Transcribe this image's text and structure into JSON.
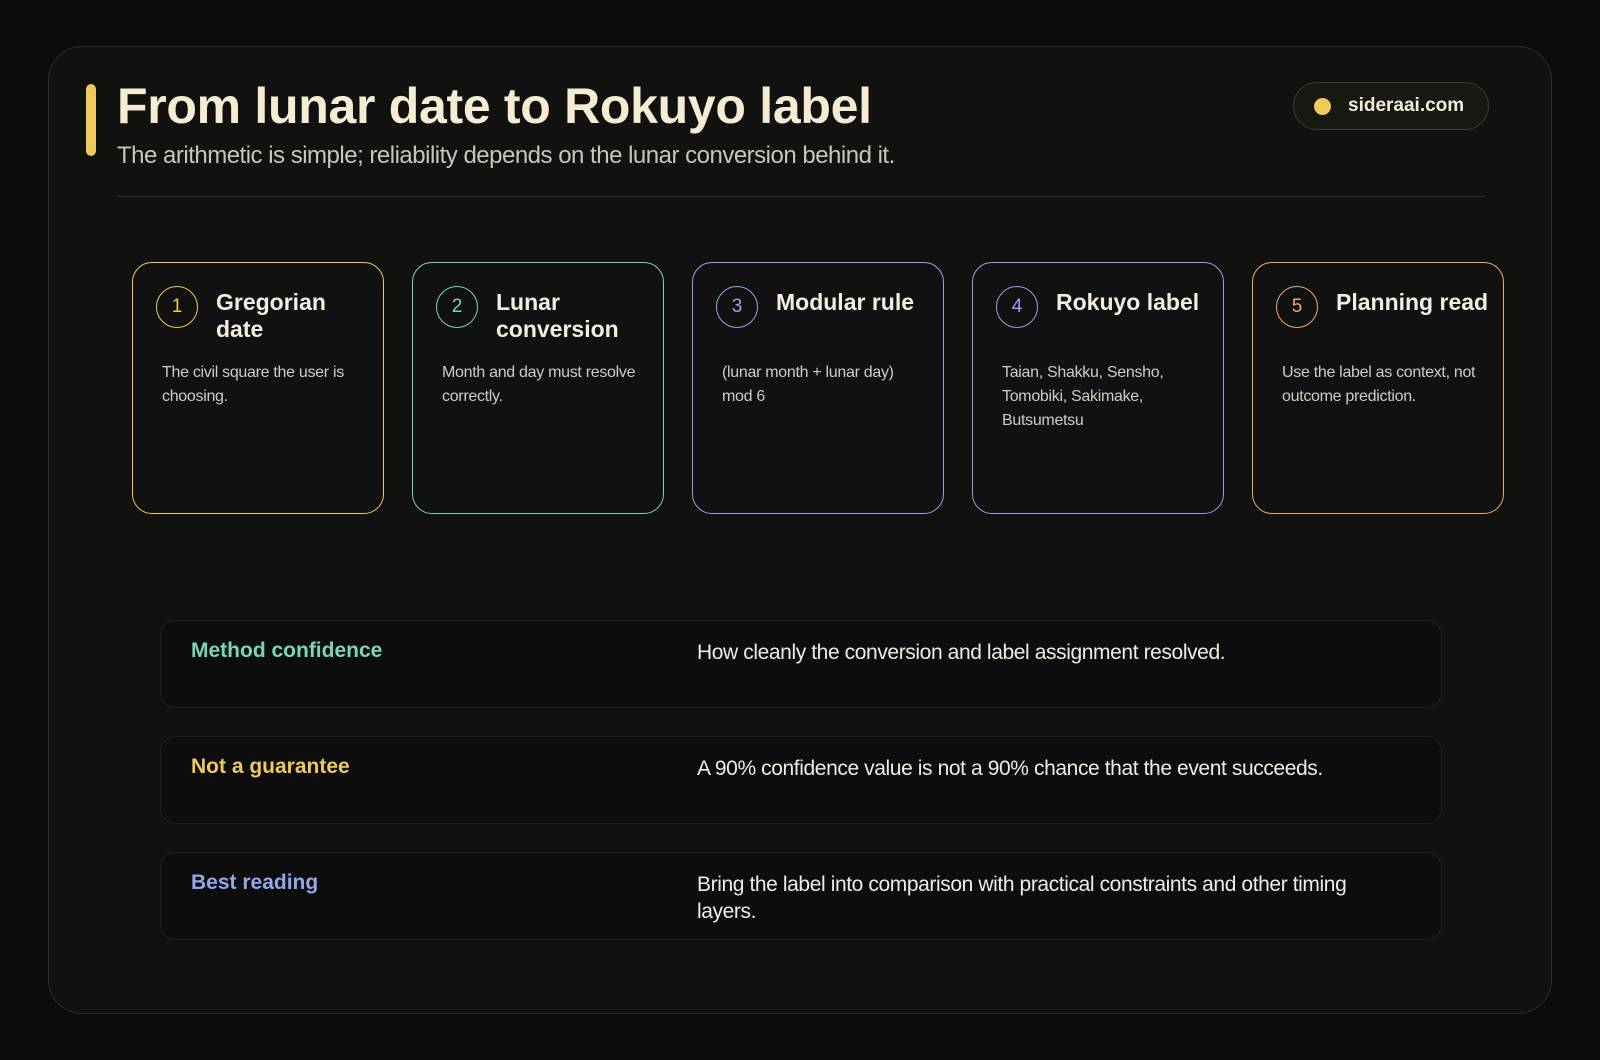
{
  "header": {
    "title": "From lunar date to Rokuyo label",
    "subtitle": "The arithmetic is simple; reliability depends on the lunar conversion behind it.",
    "site": "sideraai.com",
    "accent_color": "#f0c95c"
  },
  "steps": [
    {
      "number": "1",
      "title": "Gregorian date",
      "description": "The civil square the user is choosing.",
      "color": "#f0c95c"
    },
    {
      "number": "2",
      "title": "Lunar conversion",
      "description": "Month and day must resolve correctly.",
      "color": "#79d6b8"
    },
    {
      "number": "3",
      "title": "Modular rule",
      "description": "(lunar month + lunar day) mod 6",
      "color": "#93a8ea"
    },
    {
      "number": "4",
      "title": "Rokuyo label",
      "description": "Taian, Shakku, Sensho, Tomobiki, Sakimake, Butsumetsu",
      "color": "#a996ee"
    },
    {
      "number": "5",
      "title": "Planning read",
      "description": "Use the label as context, not outcome prediction.",
      "color": "#f0aa6c"
    }
  ],
  "notes": [
    {
      "label": "Method confidence",
      "text": "How cleanly the conversion and label assignment resolved.",
      "color": "#79d6b8"
    },
    {
      "label": "Not a guarantee",
      "text": "A 90% confidence value is not a 90% chance that the event succeeds.",
      "color": "#f0c95c"
    },
    {
      "label": "Best reading",
      "text": "Bring the label into comparison with practical constraints and other timing layers.",
      "color": "#93a8ea"
    }
  ]
}
